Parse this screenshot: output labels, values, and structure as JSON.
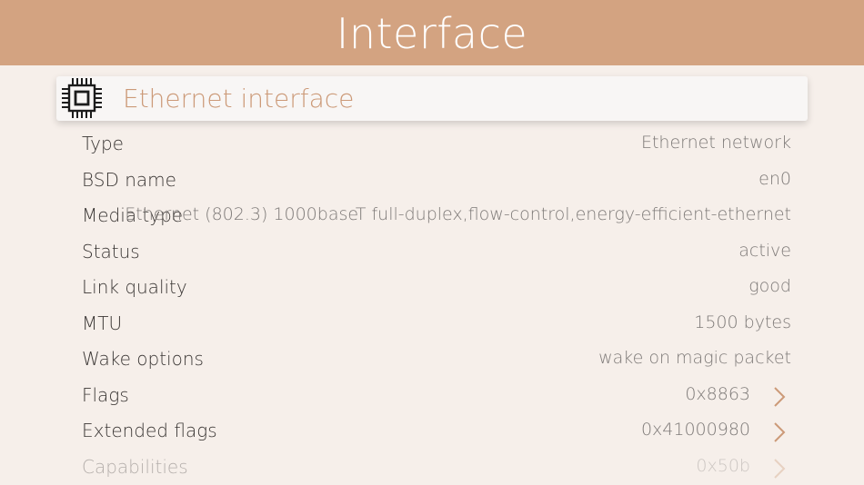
{
  "header": {
    "title": "Interface"
  },
  "section": {
    "title": "Ethernet interface",
    "icon": "chip-icon"
  },
  "rows": [
    {
      "label": "Type",
      "value": "Ethernet network"
    },
    {
      "label": "BSD name",
      "value": "en0"
    },
    {
      "label": "Media type",
      "value": "Ethernet (802.3) 1000baseT full-duplex,flow-control,energy-efficient-ethernet"
    },
    {
      "label": "Status",
      "value": "active"
    },
    {
      "label": "Link quality",
      "value": "good"
    },
    {
      "label": "MTU",
      "value": "1500 bytes"
    },
    {
      "label": "Wake options",
      "value": "wake on magic packet"
    },
    {
      "label": "Flags",
      "value": "0x8863",
      "icon": "chevron-right-icon"
    },
    {
      "label": "Extended flags",
      "value": "0x41000980",
      "icon": "chevron-right-icon"
    },
    {
      "label": "Capabilities",
      "value": "0x50b",
      "icon": "chevron-right-icon"
    }
  ],
  "colors": {
    "header_bg": "#d3a381",
    "page_bg": "#f6efea",
    "accent": "#cc9a78"
  }
}
